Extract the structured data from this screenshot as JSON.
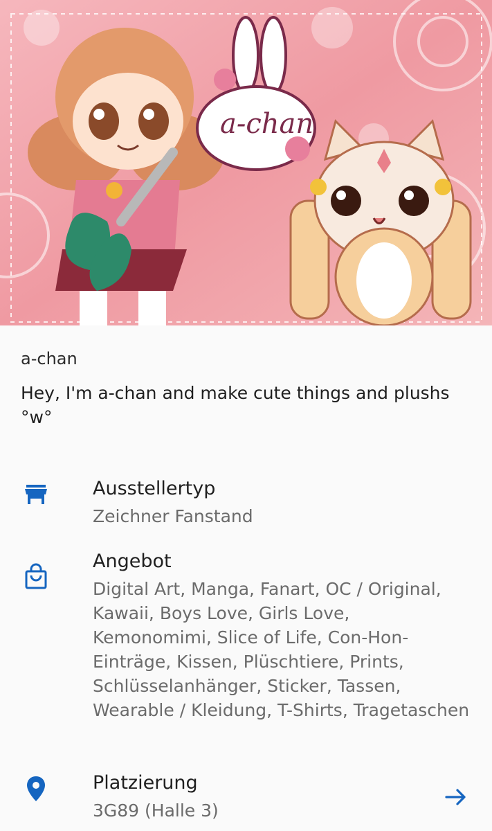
{
  "banner": {
    "logo_text": "a-chan"
  },
  "exhibitor": {
    "name": "a-chan",
    "description": "Hey, I'm a-chan and make cute things and plushs °w°"
  },
  "details": [
    {
      "icon": "store-icon",
      "title": "Ausstellertyp",
      "value": "Zeichner Fanstand"
    },
    {
      "icon": "shopping-bag-icon",
      "title": "Angebot",
      "value": "Digital Art, Manga, Fanart, OC / Original, Kawaii, Boys Love, Girls Love, Kemonomimi, Slice of Life, Con-Hon-Einträge, Kissen, Plüschtiere, Prints, Schlüsselanhänger, Sticker, Tassen, Wearable / Kleidung, T-Shirts, Tragetaschen"
    },
    {
      "icon": "location-pin-icon",
      "title": "Platzierung",
      "value": "3G89 (Halle 3)"
    }
  ],
  "colors": {
    "accent": "#1565c0",
    "banner_pink": "#f2a0a8"
  }
}
